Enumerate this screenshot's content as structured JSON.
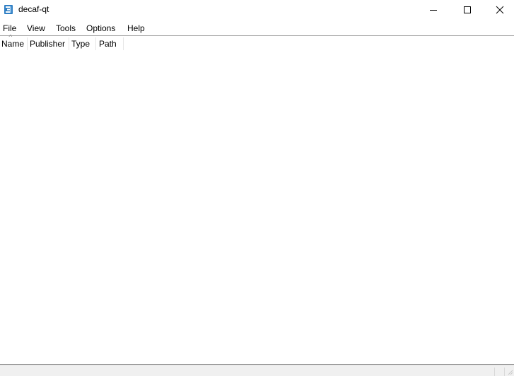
{
  "window": {
    "title": "decaf-qt",
    "icon": "decaf-app-icon",
    "controls": {
      "minimize_icon": "minimize-icon",
      "maximize_icon": "maximize-icon",
      "close_icon": "close-icon"
    }
  },
  "menubar": {
    "items": [
      {
        "label": "File"
      },
      {
        "label": "View"
      },
      {
        "label": "Tools"
      },
      {
        "label": "Options"
      },
      {
        "label": "Help"
      }
    ]
  },
  "table": {
    "columns": [
      {
        "label": "Name",
        "sort": "ascending"
      },
      {
        "label": "Publisher"
      },
      {
        "label": "Type"
      },
      {
        "label": "Path"
      }
    ],
    "rows": []
  },
  "statusbar": {
    "text": ""
  }
}
